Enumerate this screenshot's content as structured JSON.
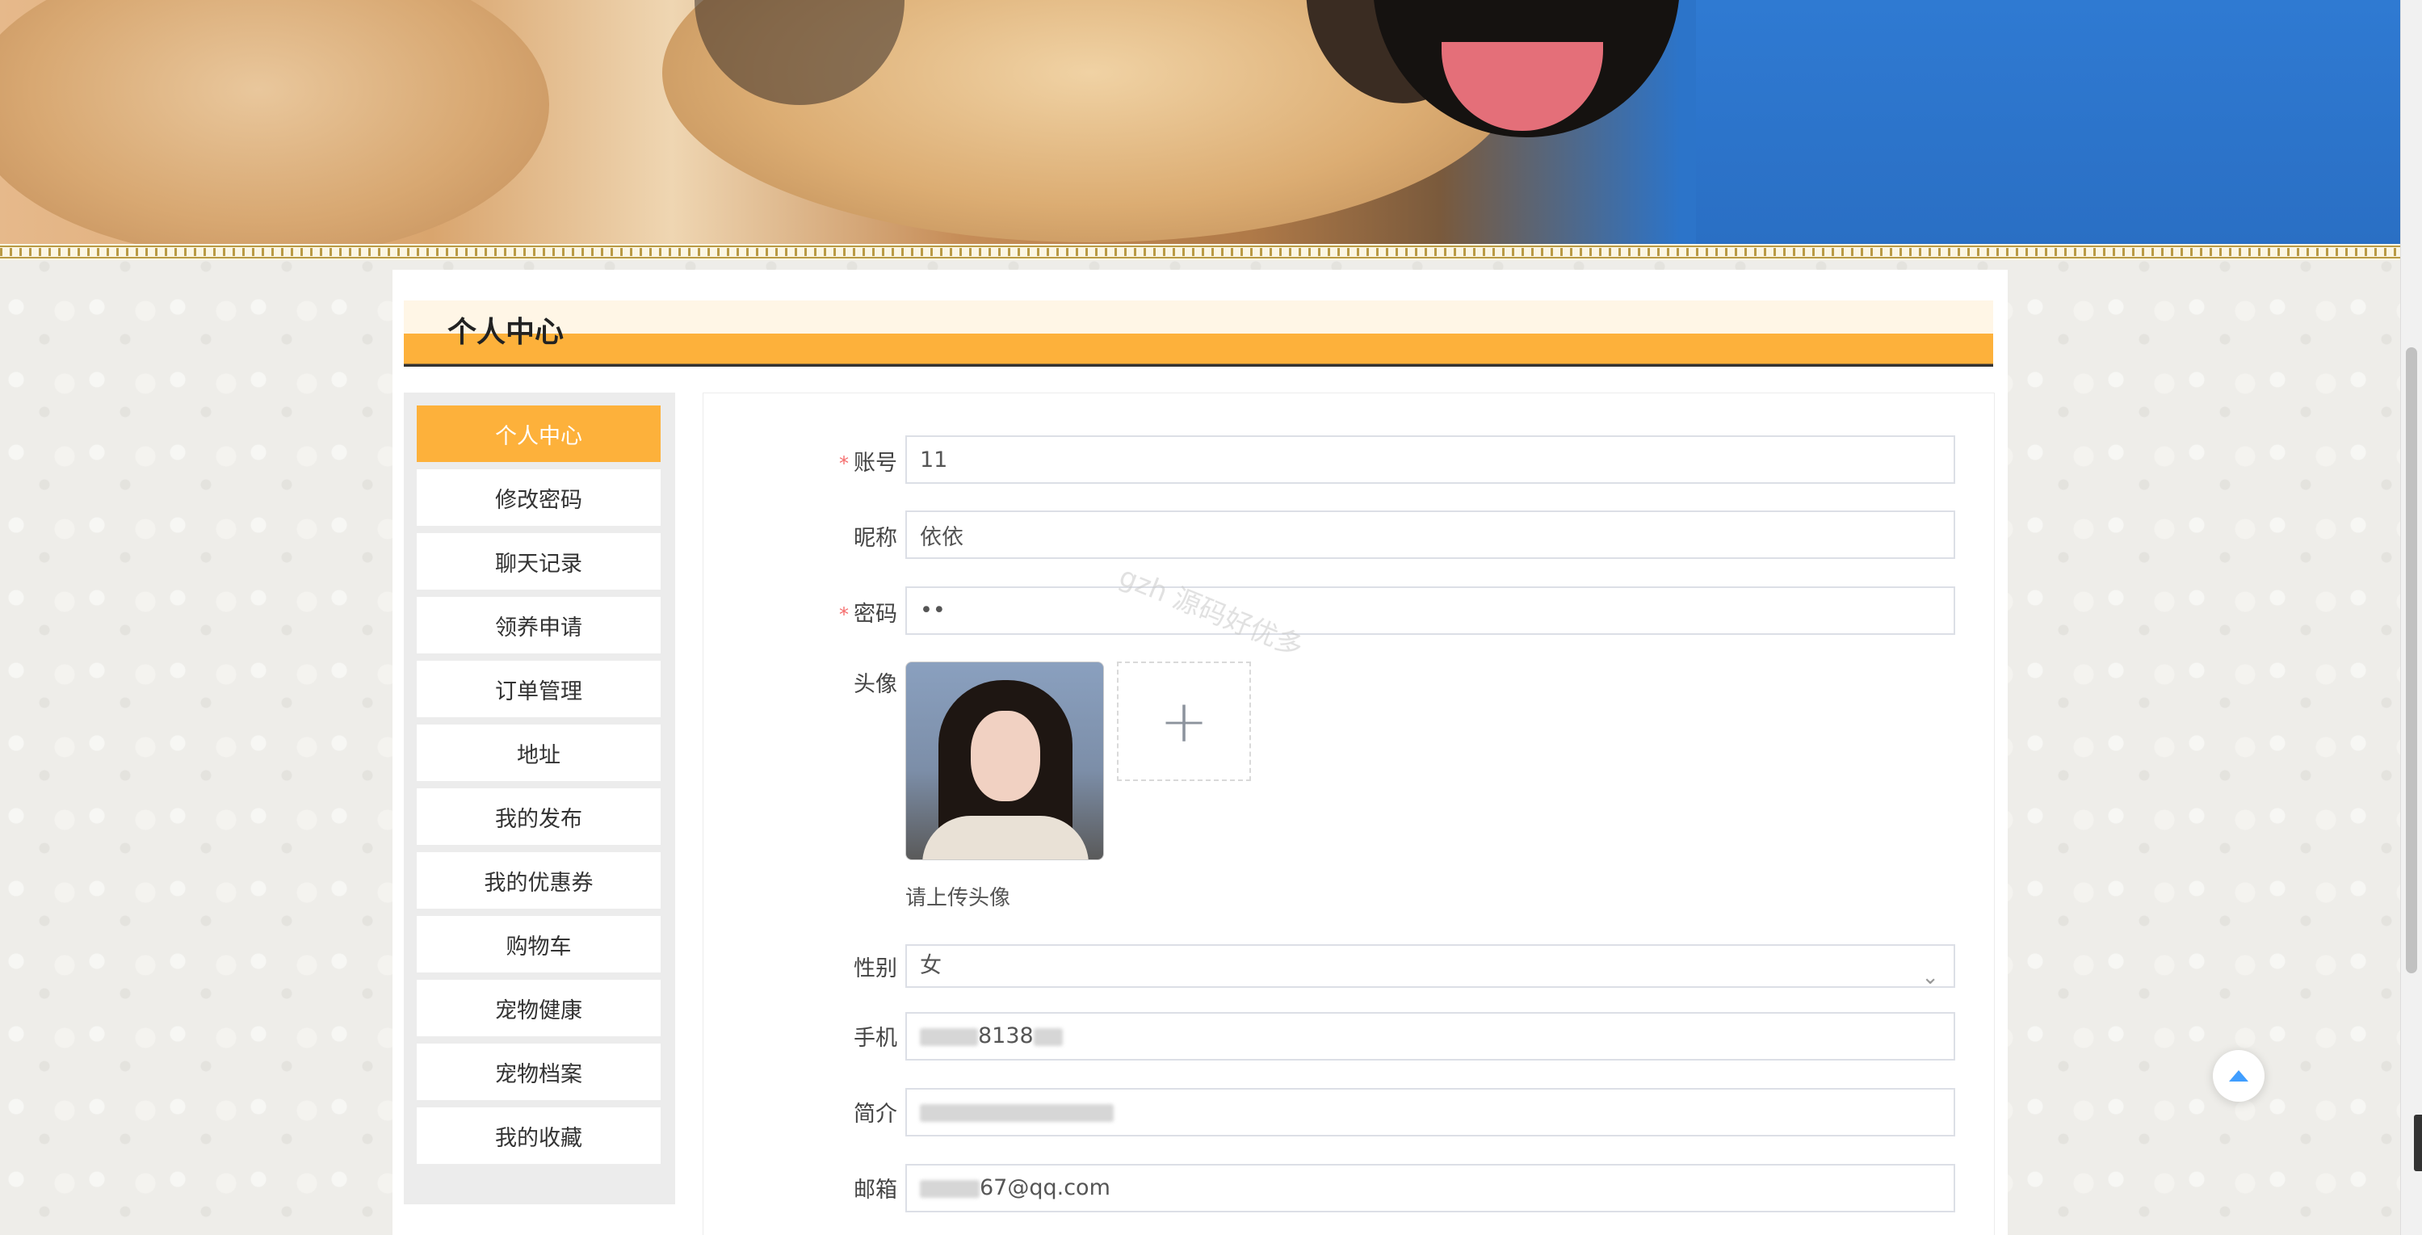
{
  "header": {
    "title": "个人中心"
  },
  "sidebar": {
    "items": [
      {
        "label": "个人中心",
        "active": true
      },
      {
        "label": "修改密码"
      },
      {
        "label": "聊天记录"
      },
      {
        "label": "领养申请"
      },
      {
        "label": "订单管理"
      },
      {
        "label": "地址"
      },
      {
        "label": "我的发布"
      },
      {
        "label": "我的优惠券"
      },
      {
        "label": "购物车"
      },
      {
        "label": "宠物健康"
      },
      {
        "label": "宠物档案"
      },
      {
        "label": "我的收藏"
      }
    ]
  },
  "form": {
    "account": {
      "label": "账号",
      "required": "*",
      "value": "11"
    },
    "nickname": {
      "label": "昵称",
      "value": "依依"
    },
    "password": {
      "label": "密码",
      "required": "*",
      "value": "••"
    },
    "avatar": {
      "label": "头像",
      "hint": "请上传头像",
      "upload_icon": "+"
    },
    "gender": {
      "label": "性别",
      "value": "女",
      "arrow": "⌄"
    },
    "phone": {
      "label": "手机",
      "value_visible": "8138"
    },
    "intro": {
      "label": "简介"
    },
    "email": {
      "label": "邮箱",
      "value_visible": "67@qq.com"
    }
  },
  "watermark": "gzh 源码好优多",
  "colors": {
    "accent": "#fdb13b",
    "required": "#f56c6c",
    "backtop": "#409eff"
  },
  "icons": {
    "backtop": "caret-up-icon",
    "upload": "plus-icon",
    "select": "chevron-down-icon"
  }
}
